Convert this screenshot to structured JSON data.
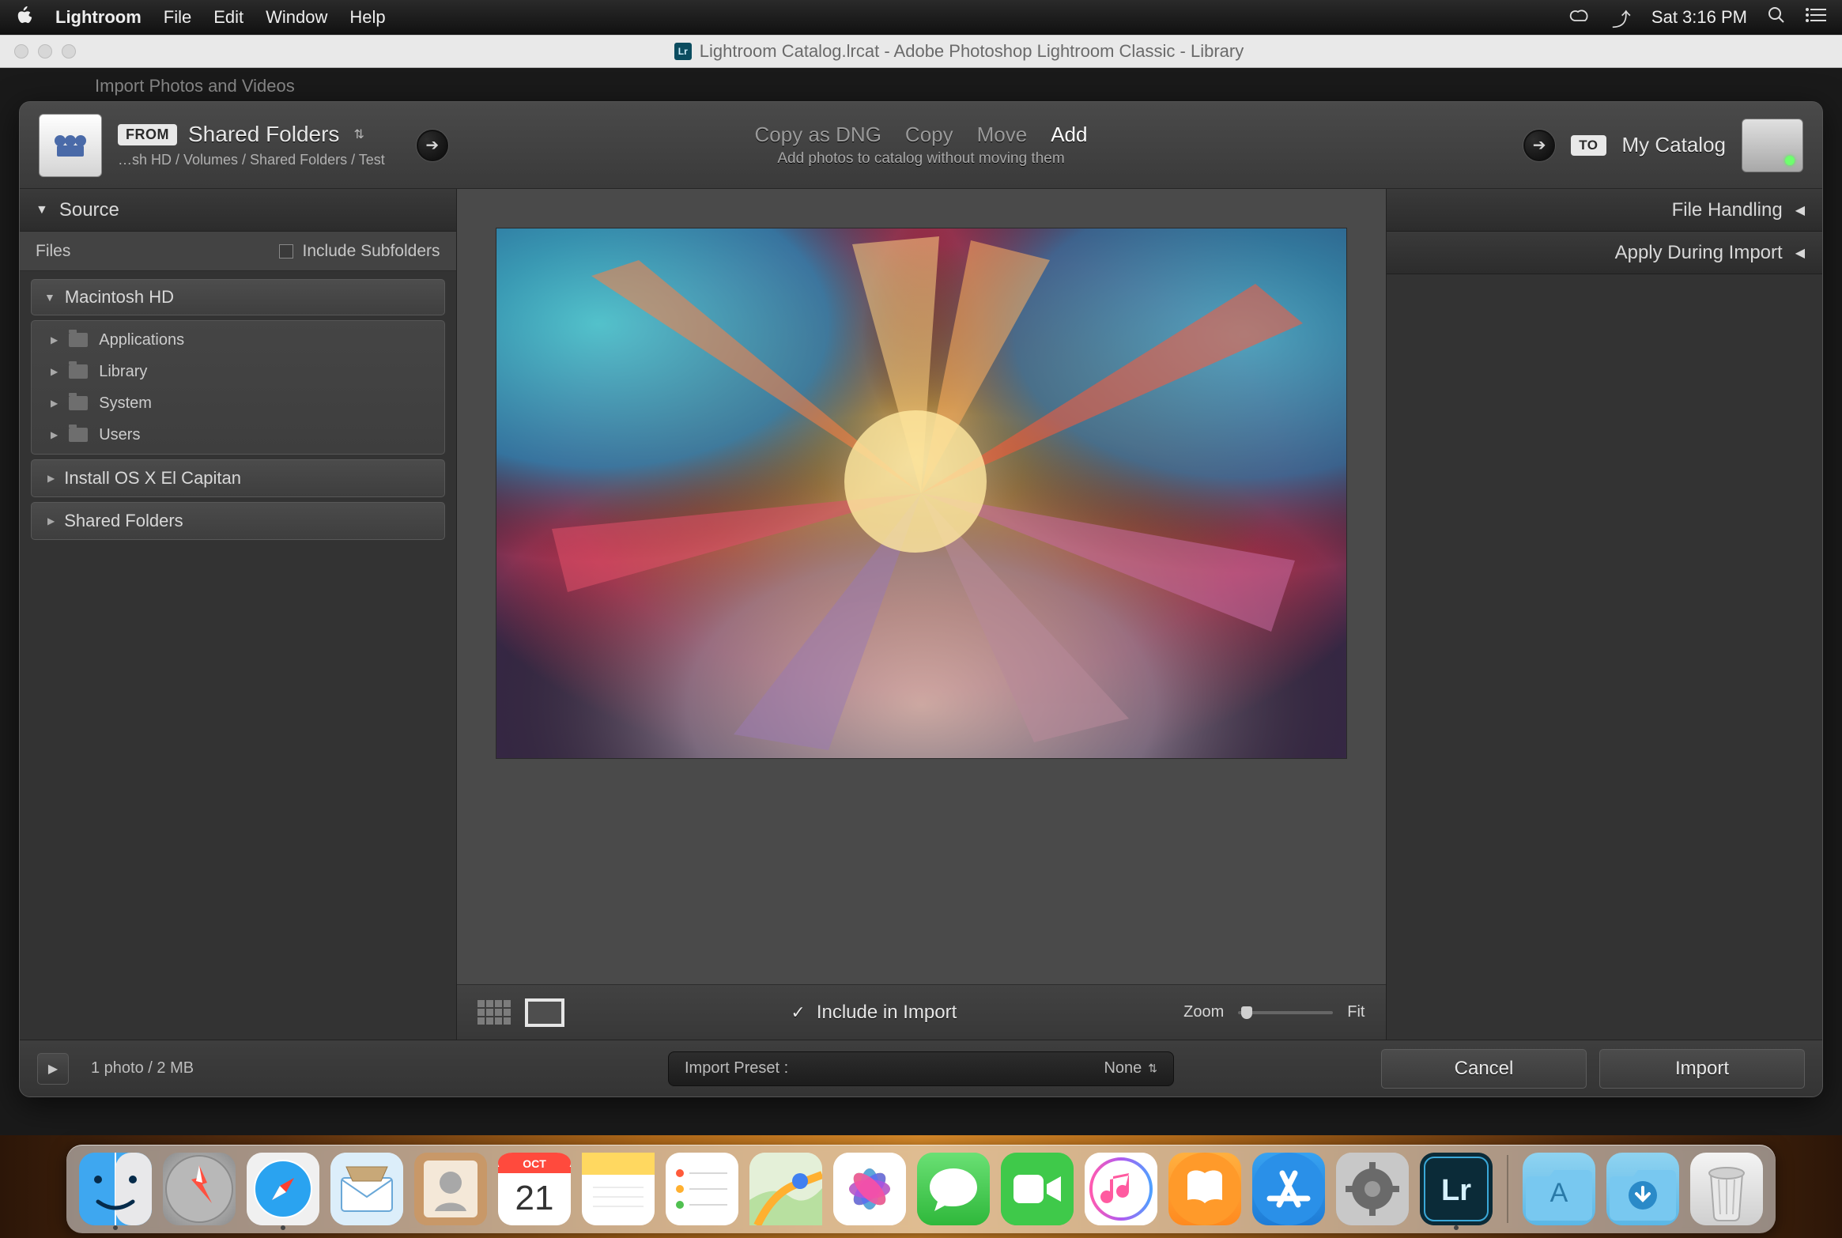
{
  "menubar": {
    "app": "Lightroom",
    "items": [
      "File",
      "Edit",
      "Window",
      "Help"
    ],
    "clock": "Sat 3:16 PM"
  },
  "window": {
    "title": "Lightroom Catalog.lrcat - Adobe Photoshop Lightroom Classic - Library",
    "hidden_header": "Import Photos and Videos"
  },
  "import": {
    "from_label": "FROM",
    "source_name": "Shared Folders",
    "source_path": "…sh HD / Volumes / Shared Folders / Test",
    "modes": {
      "dng": "Copy as DNG",
      "copy": "Copy",
      "move": "Move",
      "add": "Add"
    },
    "mode_sub": "Add photos to catalog without moving them",
    "to_label": "TO",
    "dest_name": "My Catalog"
  },
  "source_panel": {
    "title": "Source",
    "files_label": "Files",
    "include_subfolders": "Include Subfolders",
    "volumes": {
      "mac": "Macintosh HD",
      "children": [
        "Applications",
        "Library",
        "System",
        "Users"
      ],
      "installer": "Install OS X El Capitan",
      "shared": "Shared Folders"
    }
  },
  "right": {
    "file_handling": "File Handling",
    "apply_during": "Apply During Import"
  },
  "toolbar": {
    "include_label": "Include in Import",
    "zoom_label": "Zoom",
    "fit_label": "Fit"
  },
  "footer": {
    "info": "1 photo / 2 MB",
    "preset_label": "Import Preset :",
    "preset_value": "None",
    "cancel": "Cancel",
    "import": "Import"
  },
  "dock": {
    "apps": [
      {
        "name": "finder",
        "bg": "linear-gradient(#3ea7f0,#2a7acc)"
      },
      {
        "name": "launchpad",
        "bg": "radial-gradient(circle,#d5d5d5,#8a8a8a)"
      },
      {
        "name": "safari",
        "bg": "linear-gradient(#f4f4f4,#cfcfcf)"
      },
      {
        "name": "mail",
        "bg": "linear-gradient(#eaf4fb,#a8d0ef)"
      },
      {
        "name": "contacts",
        "bg": "linear-gradient(#d8b795,#b88b5d)"
      },
      {
        "name": "calendar",
        "bg": "#fff"
      },
      {
        "name": "notes",
        "bg": "linear-gradient(#fff,#ffe58a)"
      },
      {
        "name": "reminders",
        "bg": "#fff"
      },
      {
        "name": "maps",
        "bg": "linear-gradient(#eaf3e2,#b8d89a)"
      },
      {
        "name": "photos",
        "bg": "#fff"
      },
      {
        "name": "messages",
        "bg": "linear-gradient(#5cd668,#2fb83b)"
      },
      {
        "name": "facetime",
        "bg": "linear-gradient(#5cd668,#2fb83b)"
      },
      {
        "name": "itunes",
        "bg": "#fff"
      },
      {
        "name": "ibooks",
        "bg": "linear-gradient(#ffb040,#ff8a1f)"
      },
      {
        "name": "appstore",
        "bg": "linear-gradient(#38a2f0,#1e7cd6)"
      },
      {
        "name": "preferences",
        "bg": "linear-gradient(#d0d0d0,#8e8e8e)"
      },
      {
        "name": "lightroom",
        "bg": "#072531"
      }
    ],
    "right": [
      {
        "name": "apps-folder",
        "bg": "linear-gradient(#8fd3f1,#5bb7e6)"
      },
      {
        "name": "downloads-folder",
        "bg": "linear-gradient(#8fd3f1,#5bb7e6)"
      },
      {
        "name": "trash",
        "bg": "linear-gradient(#f4f4f4,#cfcfcf)"
      }
    ],
    "calendar": {
      "month": "OCT",
      "day": "21"
    }
  }
}
